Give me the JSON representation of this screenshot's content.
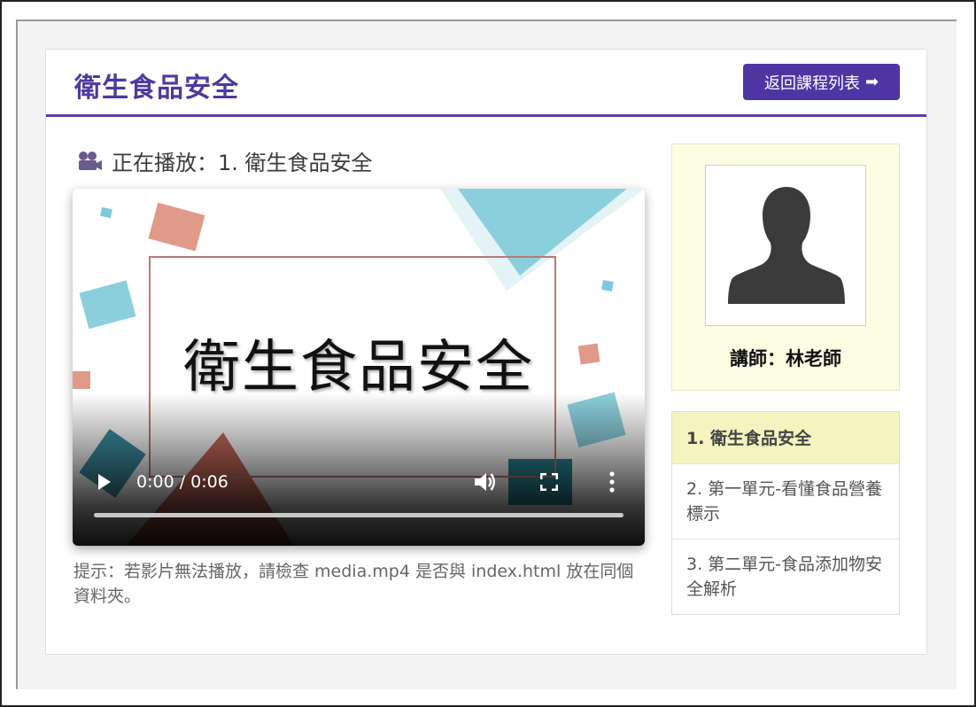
{
  "course": {
    "title": "衛生食品安全"
  },
  "header": {
    "back_label": "返回課程列表",
    "back_icon": "arrow-right-icon"
  },
  "player": {
    "now_playing": "正在播放：1. 衛生食品安全",
    "video_title_text": "衛生食品安全",
    "time": "0:00 / 0:06",
    "progress": 0
  },
  "hint": "提示：若影片無法播放，請檢查 media.mp4 是否與 index.html 放在同個資料夾。",
  "instructor": {
    "label": "講師：林老師"
  },
  "lessons": [
    {
      "label": "1. 衛生食品安全",
      "active": true
    },
    {
      "label": "2. 第一單元-看懂食品營養標示",
      "active": false
    },
    {
      "label": "3. 第二單元-食品添加物安全解析",
      "active": false
    }
  ],
  "colors": {
    "brand": "#4d35a4",
    "instructor_bg": "#fdfde4",
    "active_lesson_bg": "#f3f4bf"
  }
}
